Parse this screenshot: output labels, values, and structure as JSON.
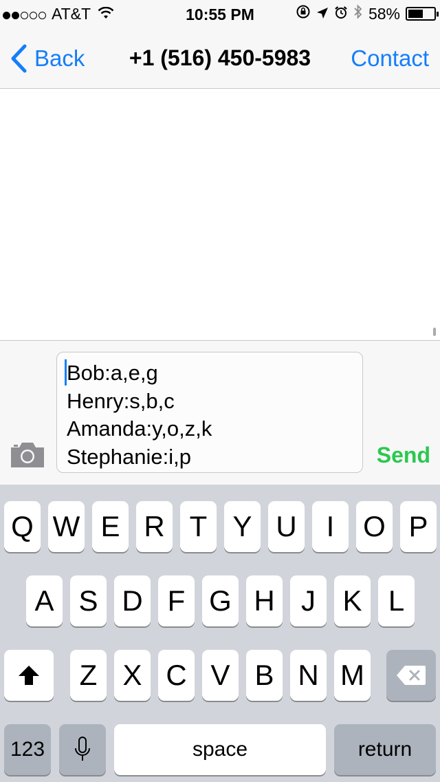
{
  "status_bar": {
    "carrier": "AT&T",
    "time": "10:55 PM",
    "battery": "58%",
    "battery_level": 0.58,
    "signal_bars_filled": 2,
    "signal_bars_total": 5,
    "icons": [
      "wifi-icon",
      "orientation-lock-icon",
      "location-icon",
      "alarm-icon",
      "bluetooth-icon",
      "battery-icon"
    ]
  },
  "nav": {
    "back_label": "Back",
    "title": "+1 (516) 450-5983",
    "contact_label": "Contact"
  },
  "compose": {
    "lines": [
      "Bob:a,e,g",
      "Henry:s,b,c",
      "Amanda:y,o,z,k",
      "Stephanie:i,p"
    ],
    "send_label": "Send"
  },
  "keyboard": {
    "row1": [
      "Q",
      "W",
      "E",
      "R",
      "T",
      "Y",
      "U",
      "I",
      "O",
      "P"
    ],
    "row2": [
      "A",
      "S",
      "D",
      "F",
      "G",
      "H",
      "J",
      "K",
      "L"
    ],
    "row3": [
      "Z",
      "X",
      "C",
      "V",
      "B",
      "N",
      "M"
    ],
    "numbers_label": "123",
    "space_label": "space",
    "return_label": "return"
  },
  "colors": {
    "accent": "#147efb",
    "send": "#2bc84f",
    "keyboard_bg": "#d1d5db"
  }
}
